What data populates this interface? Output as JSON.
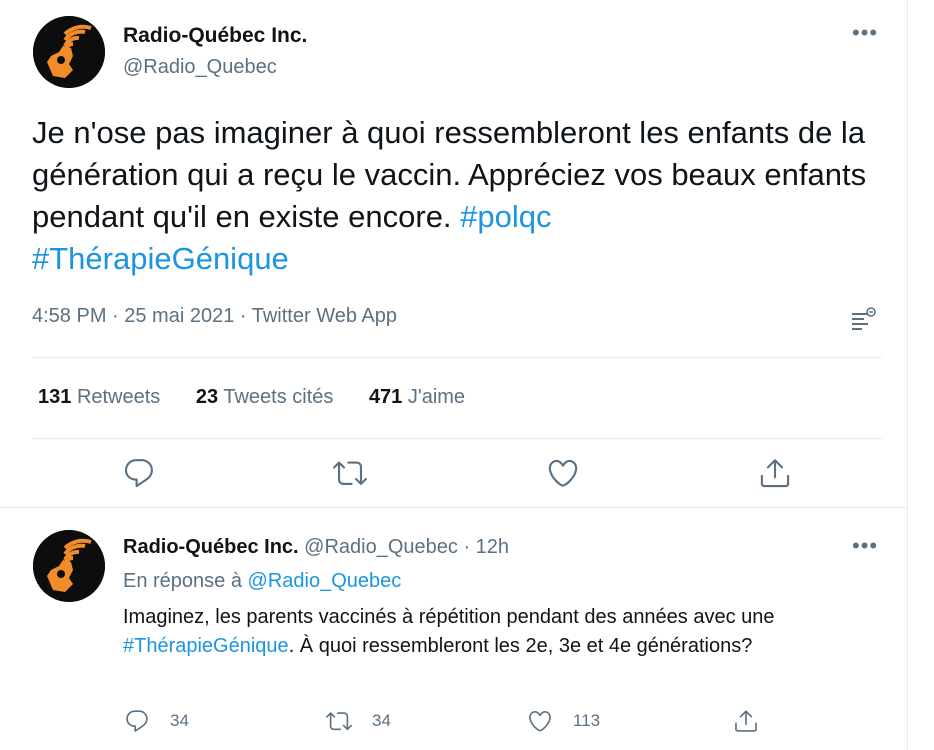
{
  "main_tweet": {
    "author_name": "Radio-Québec Inc.",
    "author_handle": "@Radio_Quebec",
    "more_label": "•••",
    "text_plain": "Je n'ose pas imaginer à quoi ressembleront les enfants de la génération qui a reçu le vaccin. Appréciez vos beaux enfants pendant qu'il en existe encore. ",
    "hashtag_1": "#polqc",
    "hashtag_2": "#ThérapieGénique",
    "timestamp": "4:58 PM · 25 mai 2021 · Twitter Web App",
    "retweets_count": "131",
    "retweets_label": "Retweets",
    "quotes_count": "23",
    "quotes_label": "Tweets cités",
    "likes_count": "471",
    "likes_label": "J'aime",
    "actions": [
      "reply-icon",
      "retweet-icon",
      "like-icon",
      "share-icon"
    ]
  },
  "reply_tweet": {
    "author_name": "Radio-Québec Inc.",
    "author_handle_time": "@Radio_Quebec · 12h",
    "more_label": "•••",
    "reply_prefix": "En réponse à ",
    "reply_target": "@Radio_Quebec",
    "text_part_1": "Imaginez, les parents vaccinés à répétition pendant des années avec une ",
    "hashtag": "#ThérapieGénique",
    "text_part_2": ". À quoi ressembleront les 2e, 3e et 4e générations?",
    "reply_count": "34",
    "retweet_count": "34",
    "like_count": "113"
  },
  "colors": {
    "link": "#1b95e0",
    "secondary_text": "#5b7083",
    "primary_text": "#0f1419",
    "divider": "#e6ecf0",
    "avatar_orange": "#f28c28"
  }
}
